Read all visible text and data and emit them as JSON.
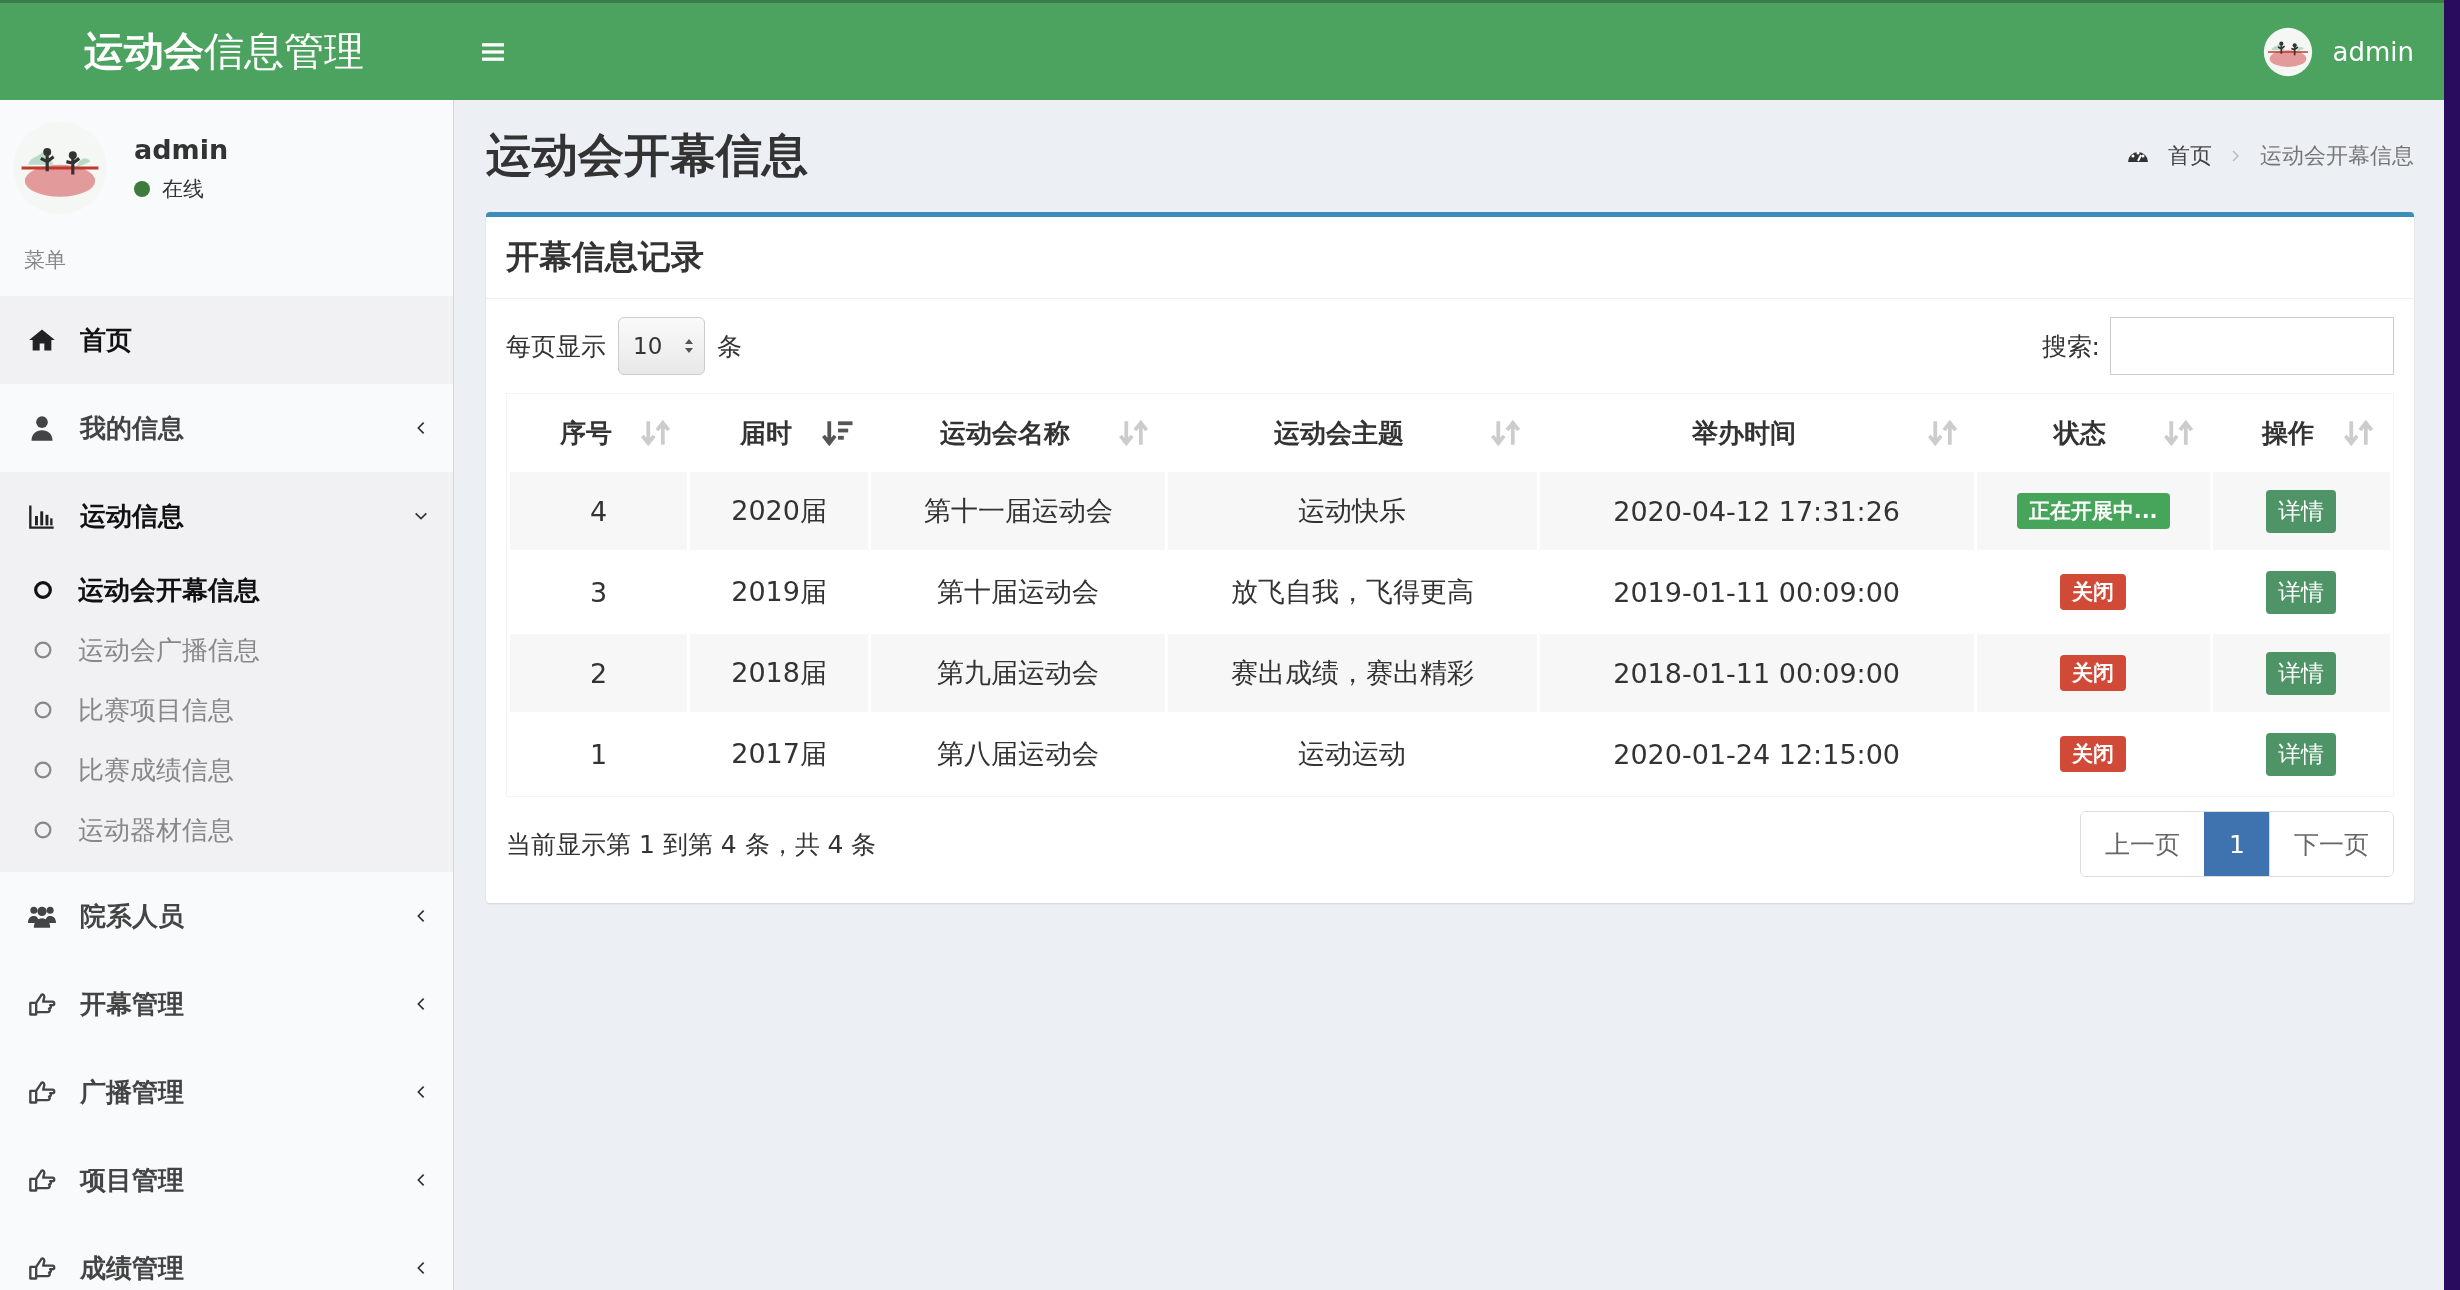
{
  "header": {
    "title": "**运动会**信息管理",
    "user": "admin"
  },
  "sidebar": {
    "user": {
      "name": "admin",
      "status": "在线",
      "online": true
    },
    "menu_label": "菜单",
    "items": [
      {
        "label": "首页",
        "kind": "link",
        "highlighted": true
      },
      {
        "label": "我的信息",
        "kind": "group",
        "expanded": false,
        "highlighted": false
      },
      {
        "label": "运动信息",
        "kind": "group",
        "expanded": true,
        "highlighted": true,
        "children": [
          {
            "label": "运动会开幕信息",
            "selected": true
          },
          {
            "label": "运动会广播信息",
            "selected": false
          },
          {
            "label": "比赛项目信息",
            "selected": false
          },
          {
            "label": "比赛成绩信息",
            "selected": false
          },
          {
            "label": "运动器材信息",
            "selected": false
          }
        ]
      },
      {
        "label": "院系人员",
        "kind": "group",
        "expanded": false,
        "highlighted": false
      },
      {
        "label": "开幕管理",
        "kind": "group",
        "expanded": false,
        "highlighted": false
      },
      {
        "label": "广播管理",
        "kind": "group",
        "expanded": false,
        "highlighted": false
      },
      {
        "label": "项目管理",
        "kind": "group",
        "expanded": false,
        "highlighted": false
      },
      {
        "label": "成绩管理",
        "kind": "group",
        "expanded": false,
        "highlighted": false
      }
    ]
  },
  "page": {
    "title": "运动会开幕信息",
    "breadcrumb": [
      "首页",
      "运动会开幕信息"
    ]
  },
  "box": {
    "title": "开幕信息记录",
    "length_label_before": "每页显示",
    "length_value": "10",
    "length_label_after": "条",
    "search_label": "搜索:",
    "table": {
      "columns": [
        {
          "label": "序号",
          "sorted": false
        },
        {
          "label": "届时",
          "sorted": true
        },
        {
          "label": "运动会名称",
          "sorted": false
        },
        {
          "label": "运动会主题",
          "sorted": false
        },
        {
          "label": "举办时间",
          "sorted": false
        },
        {
          "label": "状态",
          "sorted": false
        },
        {
          "label": "操作",
          "sorted": false
        }
      ],
      "rows": [
        {
          "cells": [
            "4",
            "2020届",
            "第十一届运动会",
            "运动快乐",
            "2020-04-12 17:31:26"
          ],
          "status": {
            "text": "正在开展中...",
            "kind": "active"
          },
          "action": "详情"
        },
        {
          "cells": [
            "3",
            "2019届",
            "第十届运动会",
            "放飞自我，飞得更高",
            "2019-01-11 00:09:00"
          ],
          "status": {
            "text": "关闭",
            "kind": "closed"
          },
          "action": "详情"
        },
        {
          "cells": [
            "2",
            "2018届",
            "第九届运动会",
            "赛出成绩，赛出精彩",
            "2018-01-11 00:09:00"
          ],
          "status": {
            "text": "关闭",
            "kind": "closed"
          },
          "action": "详情"
        },
        {
          "cells": [
            "1",
            "2017届",
            "第八届运动会",
            "运动运动",
            "2020-01-24 12:15:00"
          ],
          "status": {
            "text": "关闭",
            "kind": "closed"
          },
          "action": "详情"
        }
      ]
    },
    "info": "当前显示第 1 到第 4 条，共 4 条",
    "pagination": {
      "prev": "上一页",
      "pages": [
        {
          "label": "1",
          "selected": true
        }
      ],
      "next": "下一页"
    }
  }
}
